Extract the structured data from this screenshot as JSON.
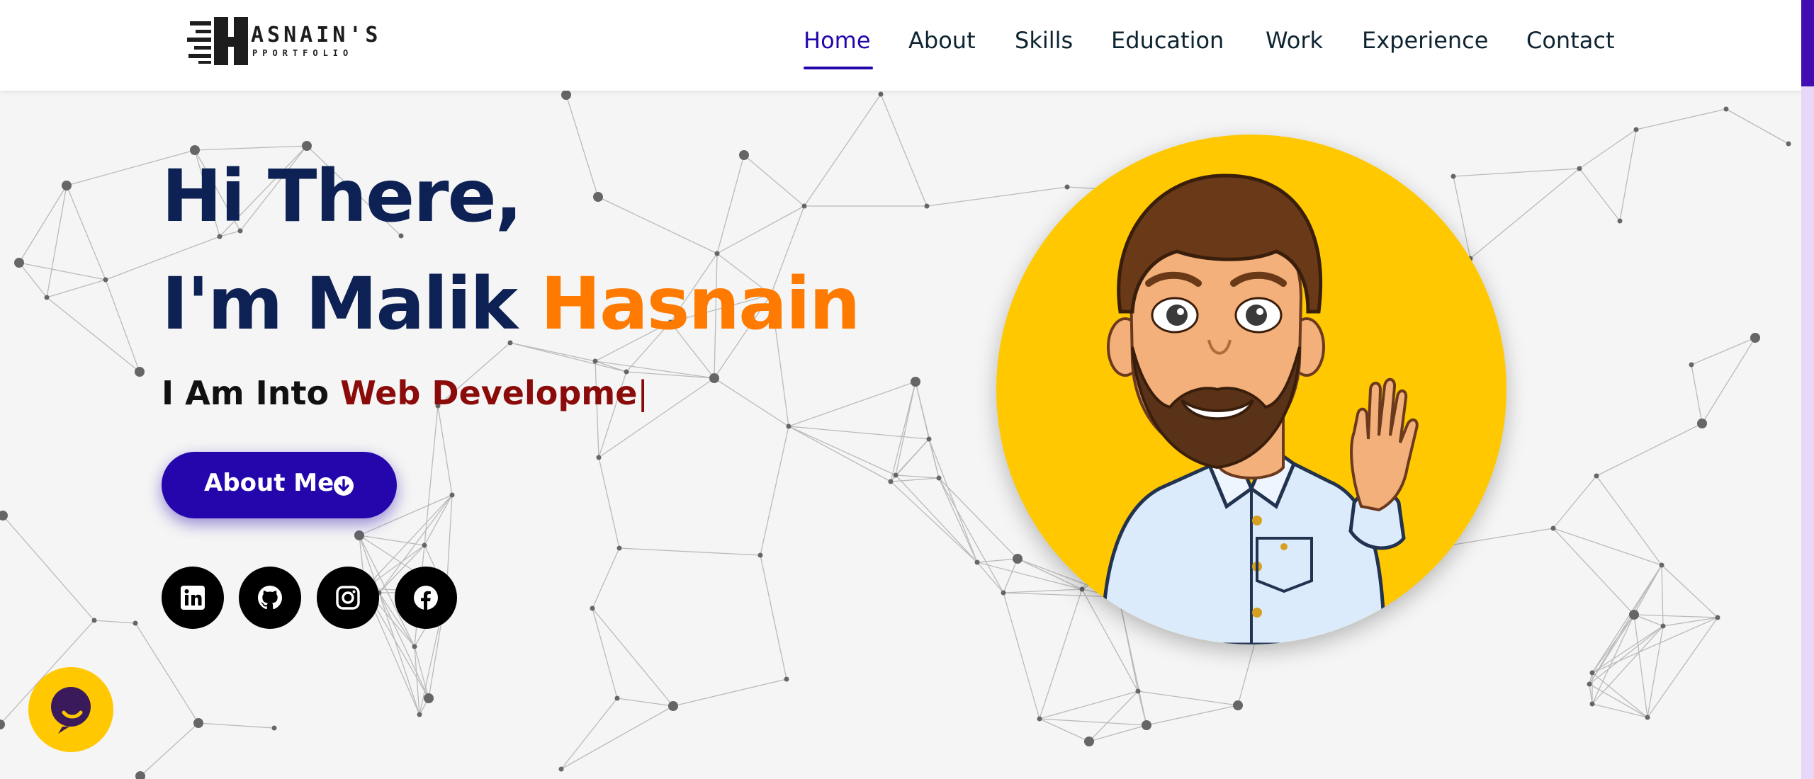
{
  "header": {
    "logo_title": "ASNAIN'S",
    "logo_subtitle": "PPORTFOLIO",
    "nav": [
      {
        "label": "Home",
        "active": true
      },
      {
        "label": "About",
        "active": false
      },
      {
        "label": "Skills",
        "active": false
      },
      {
        "label": "Education",
        "active": false
      },
      {
        "label": "Work",
        "active": false
      },
      {
        "label": "Experience",
        "active": false
      },
      {
        "label": "Contact",
        "active": false
      }
    ]
  },
  "hero": {
    "greeting": "Hi There,",
    "intro": "I'm Malik ",
    "name": "Hasnain",
    "typed_prefix": "I Am Into ",
    "typed_text": "Web Developme",
    "caret": "|",
    "button_label": "About Me",
    "button_icon": "arrow-circle-down-icon",
    "socials": [
      {
        "name": "linkedin-icon"
      },
      {
        "name": "github-icon"
      },
      {
        "name": "instagram-icon"
      },
      {
        "name": "facebook-icon"
      }
    ]
  },
  "chat": {
    "icon": "chat-icon"
  },
  "colors": {
    "primary": "#2506ad",
    "accent": "#ff7a00",
    "heading": "#0e2154",
    "typed": "#8b0a0a",
    "avatar_bg": "#ffc800",
    "background": "#f5f5f5"
  }
}
